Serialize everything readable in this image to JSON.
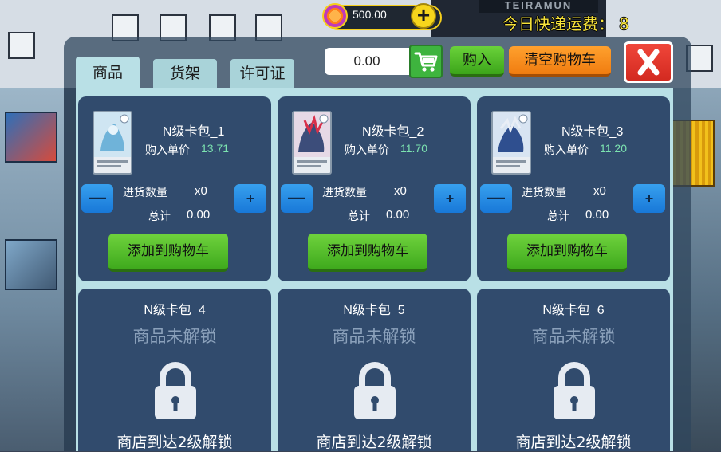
{
  "hud": {
    "coins": "500.00",
    "add_label": "+",
    "shipping_label": "今日快递运费：",
    "shipping_value": "8"
  },
  "tabs": [
    {
      "label": "商品",
      "active": true
    },
    {
      "label": "货架",
      "active": false
    },
    {
      "label": "许可证",
      "active": false
    }
  ],
  "toolbar": {
    "cart_total": "0.00",
    "buy_label": "购入",
    "clear_label": "清空购物车"
  },
  "items": [
    {
      "name": "N级卡包_1",
      "price_label": "购入单价",
      "price": "13.71",
      "qty_label": "进货数量",
      "qty": "x0",
      "total_label": "总计",
      "total": "0.00",
      "add_label": "添加到购物车",
      "minus_label": "—",
      "plus_label": "+"
    },
    {
      "name": "N级卡包_2",
      "price_label": "购入单价",
      "price": "11.70",
      "qty_label": "进货数量",
      "qty": "x0",
      "total_label": "总计",
      "total": "0.00",
      "add_label": "添加到购物车",
      "minus_label": "—",
      "plus_label": "+"
    },
    {
      "name": "N级卡包_3",
      "price_label": "购入单价",
      "price": "11.20",
      "qty_label": "进货数量",
      "qty": "x0",
      "total_label": "总计",
      "total": "0.00",
      "add_label": "添加到购物车",
      "minus_label": "—",
      "plus_label": "+"
    }
  ],
  "locked_items": [
    {
      "name": "N级卡包_4",
      "status": "商品未解锁",
      "requirement": "商店到达2级解锁"
    },
    {
      "name": "N级卡包_5",
      "status": "商品未解锁",
      "requirement": "商店到达2级解锁"
    },
    {
      "name": "N级卡包_6",
      "status": "商品未解锁",
      "requirement": "商店到达2级解锁"
    }
  ],
  "colors": {
    "panel_bg": "#b9e0e6",
    "card_bg": "#314b6d",
    "price_color": "#7ce3b0",
    "buy_green": "#3ca51a",
    "clear_orange": "#f07c10",
    "close_red": "#d32a20",
    "shipping_yellow": "#f7e33c"
  }
}
